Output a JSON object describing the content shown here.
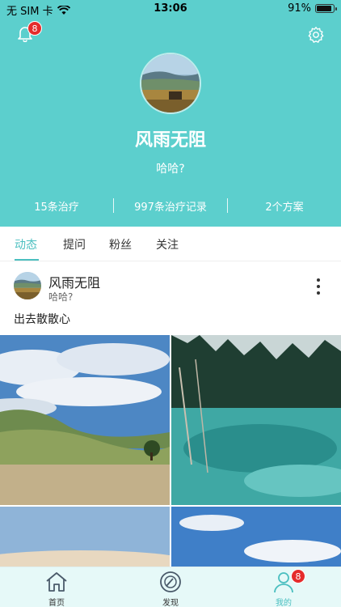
{
  "status_bar": {
    "carrier": "无 SIM 卡",
    "time": "13:06",
    "battery": "91%",
    "battery_level": 0.91
  },
  "header": {
    "notification_badge": "8"
  },
  "profile": {
    "name": "风雨无阻",
    "bio": "哈哈?",
    "stats": [
      "15条治疗",
      "997条治疗记录",
      "2个方案"
    ]
  },
  "tabs": [
    "动态",
    "提问",
    "粉丝",
    "关注"
  ],
  "post": {
    "author": "风雨无阻",
    "subtitle": "哈哈?",
    "text": "出去散散心"
  },
  "bottom_nav": [
    {
      "label": "首页",
      "icon": "home-icon"
    },
    {
      "label": "发现",
      "icon": "compass-icon"
    },
    {
      "label": "我的",
      "icon": "person-icon",
      "badge": "8"
    }
  ],
  "colors": {
    "accent": "#5ccfcd",
    "badge": "#e52c2c",
    "tab_active": "#4bbfc0"
  }
}
